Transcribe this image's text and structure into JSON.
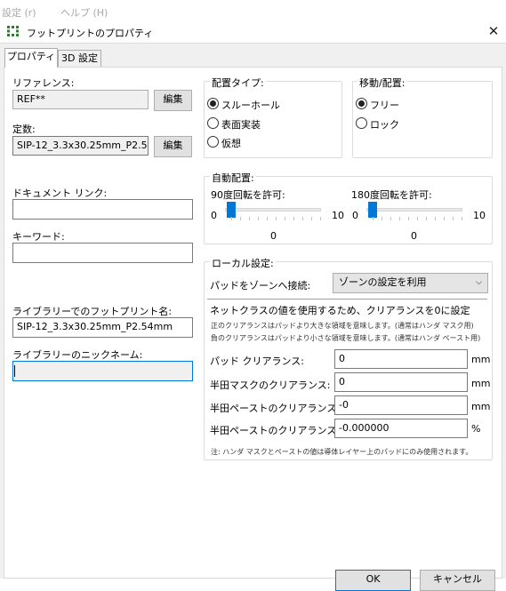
{
  "menubar": {
    "items": [
      "設定 (r)",
      "ヘルプ (H)"
    ]
  },
  "dialog": {
    "title": "フットプリントのプロパティ",
    "tabs": [
      {
        "label": "プロパティ"
      },
      {
        "label": "3D 設定"
      }
    ]
  },
  "left": {
    "reference_label": "リファレンス:",
    "reference_value": "REF**",
    "value_label": "定数:",
    "value_value": "SIP-12_3.3x30.25mm_P2.54mm",
    "edit_label": "編集",
    "doc_link_label": "ドキュメント リンク:",
    "doc_link_value": "",
    "keywords_label": "キーワード:",
    "keywords_value": "",
    "lib_fp_name_label": "ライブラリーでのフットプリント名:",
    "lib_fp_name_value": "SIP-12_3.3x30.25mm_P2.54mm",
    "lib_nickname_label": "ライブラリーのニックネーム:",
    "lib_nickname_value": ""
  },
  "placement_type": {
    "title": "配置タイプ:",
    "options": [
      "スルーホール",
      "表面実装",
      "仮想"
    ],
    "selected": 0
  },
  "move_place": {
    "title": "移動/配置:",
    "options": [
      "フリー",
      "ロック"
    ],
    "selected": 0
  },
  "auto_place": {
    "title": "自動配置:",
    "rot90_label": "90度回転を許可:",
    "rot180_label": "180度回転を許可:",
    "min_label": "0",
    "max_label": "10",
    "rot90_value": "0",
    "rot180_value": "0",
    "rot90_level": 0,
    "rot180_level": 0
  },
  "local": {
    "title": "ローカル設定:",
    "pad_zone_label": "パッドをゾーンへ接続:",
    "pad_zone_value": "ゾーンの設定を利用",
    "netclass_msg": "ネットクラスの値を使用するため、クリアランスを0に設定",
    "note1": "正のクリアランスはパッドより大きな領域を意味します。(通常はハンダ マスク用)",
    "note2": "負のクリアランスはパッドより小さな領域を意味します。(通常はハンダ ペースト用)",
    "fields": [
      {
        "label": "パッド クリアランス:",
        "value": "0",
        "unit": "mm"
      },
      {
        "label": "半田マスクのクリアランス:",
        "value": "0",
        "unit": "mm"
      },
      {
        "label": "半田ペーストのクリアランス:",
        "value": "-0",
        "unit": "mm"
      },
      {
        "label": "半田ペーストのクリアランス比:",
        "value": "-0.000000",
        "unit": "%"
      }
    ],
    "footnote": "注: ハンダ マスクとペーストの値は導体レイヤー上のパッドにのみ使用されます。"
  },
  "footer": {
    "ok_label": "OK",
    "cancel_label": "キャンセル"
  }
}
